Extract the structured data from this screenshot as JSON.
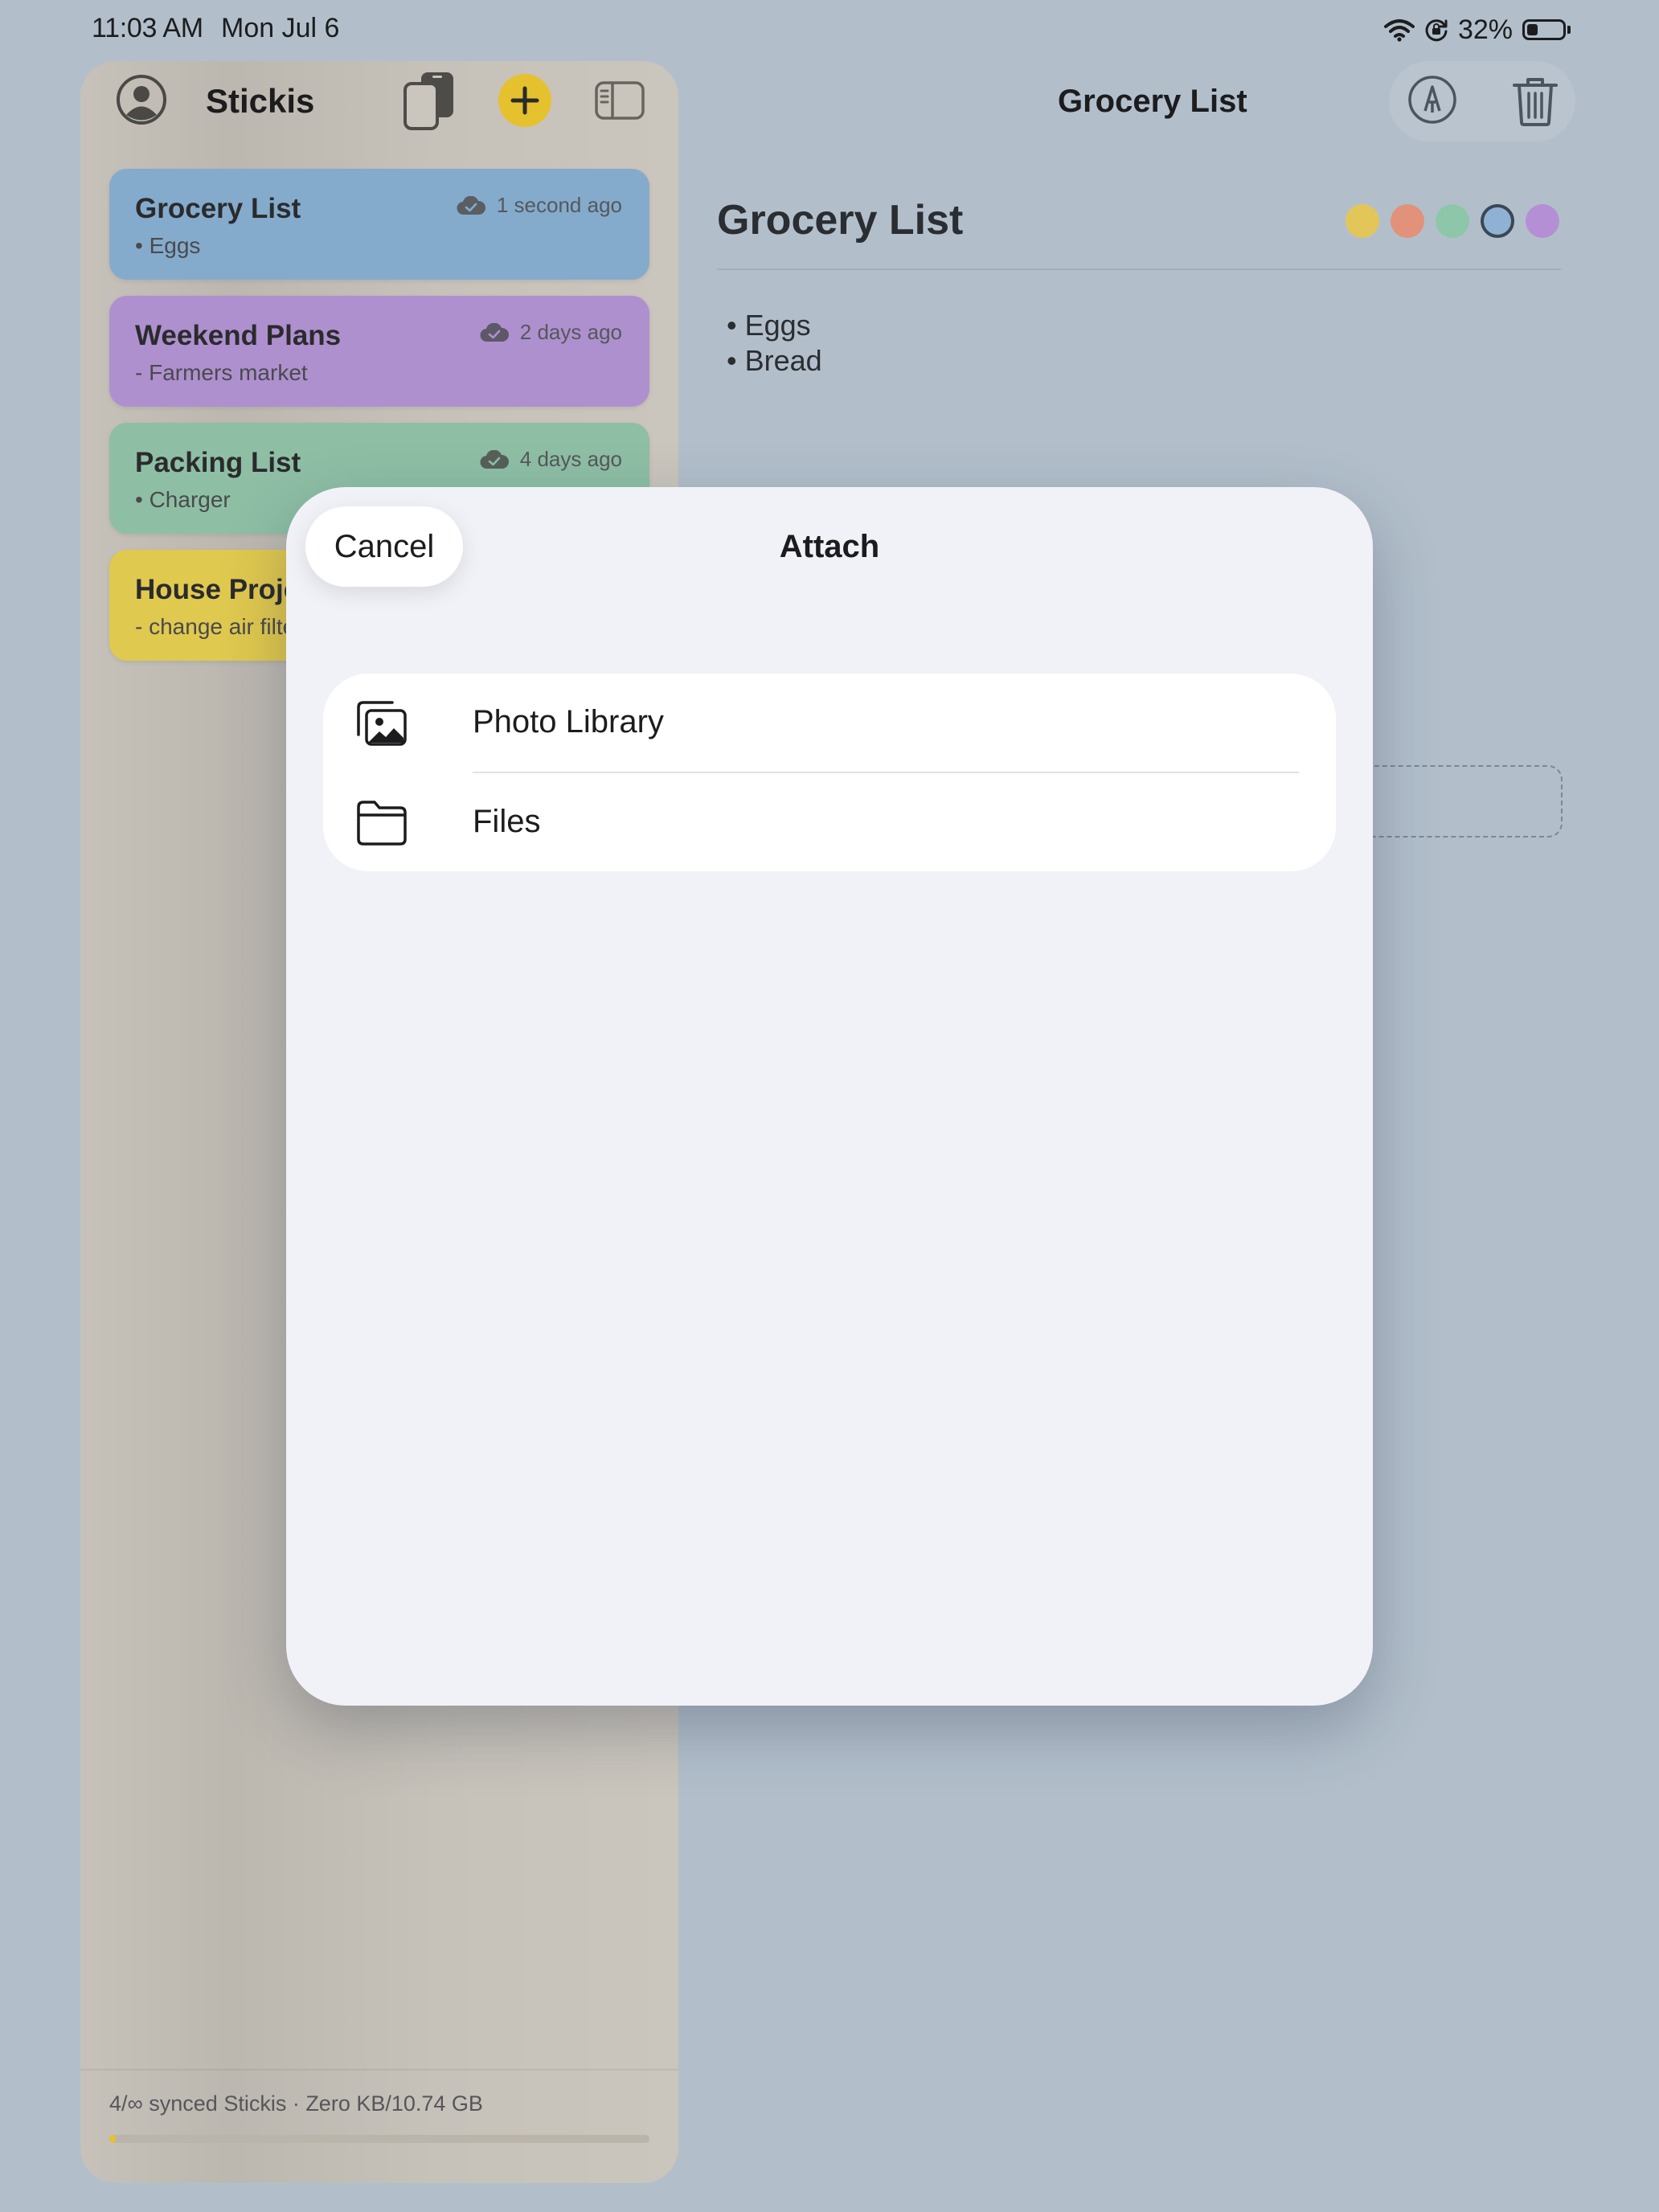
{
  "status_bar": {
    "time": "11:03 AM",
    "date": "Mon Jul 6",
    "battery": "32%",
    "icons": [
      "wifi-icon",
      "orientation-lock-icon",
      "battery-icon"
    ]
  },
  "sidebar": {
    "title": "Stickis",
    "icons": [
      "person-circle-icon",
      "copy-device-icon",
      "plus-icon",
      "sidebar-toggle-icon"
    ],
    "notes": [
      {
        "title": "Grocery List",
        "preview": "• Eggs",
        "time": "1 second ago",
        "color": "#84abcc"
      },
      {
        "title": "Weekend Plans",
        "preview": "- Farmers market",
        "time": "2 days ago",
        "color": "#ae90cf"
      },
      {
        "title": "Packing List",
        "preview": "• Charger",
        "time": "4 days ago",
        "color": "#8ebfa5"
      },
      {
        "title": "House Projects",
        "preview": "- change air filters",
        "time": "",
        "color": "#e0c94f"
      }
    ],
    "footer": {
      "text": "4/∞ synced Stickis  ·  Zero KB/10.74 GB",
      "progress": 0.01,
      "accent": "#e6c12e"
    }
  },
  "main": {
    "header_title": "Grocery List",
    "icons": [
      "pencil-circle-icon",
      "trash-icon"
    ],
    "note_title": "Grocery List",
    "color_options": [
      "#e3c659",
      "#e2917a",
      "#8ec6a9",
      "#8fb2d4",
      "#b58fd6"
    ],
    "selected_color": "#8fb2d4",
    "lines": [
      "• Eggs",
      "• Bread"
    ]
  },
  "modal": {
    "title": "Attach",
    "cancel_label": "Cancel",
    "options": [
      {
        "label": "Photo Library",
        "icon": "photo-library-icon"
      },
      {
        "label": "Files",
        "icon": "folder-icon"
      }
    ]
  }
}
